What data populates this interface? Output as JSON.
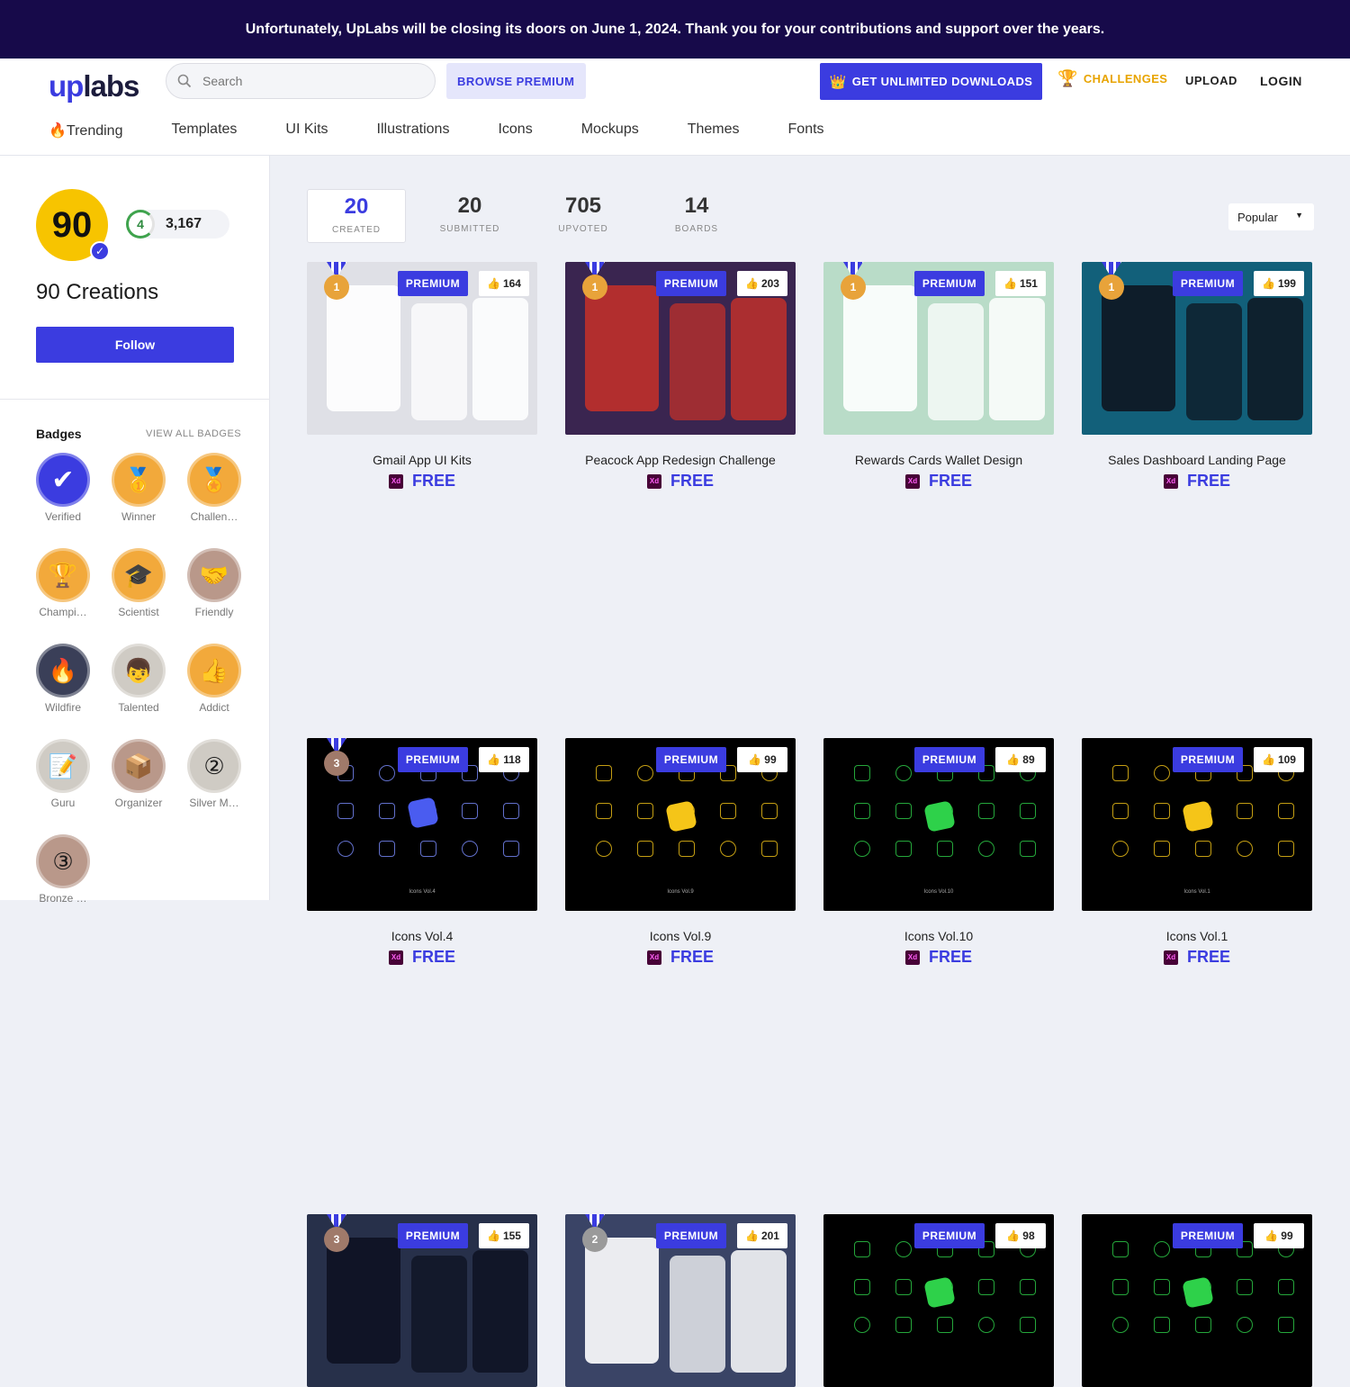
{
  "banner": {
    "text": "Unfortunately, UpLabs will be closing its doors on June 1, 2024. Thank you for your contributions and support over the years."
  },
  "header": {
    "logo_up": "up",
    "logo_labs": "labs",
    "search_placeholder": "Search",
    "browse_premium": "BROWSE PREMIUM",
    "unlimited": "GET UNLIMITED DOWNLOADS",
    "challenges": "CHALLENGES",
    "upload": "UPLOAD",
    "login": "LOGIN"
  },
  "nav": {
    "items": [
      "🔥Trending",
      "Templates",
      "UI Kits",
      "Illustrations",
      "Icons",
      "Mockups",
      "Themes",
      "Fonts"
    ]
  },
  "profile": {
    "level": "4",
    "points": "3,167",
    "creations": "90 Creations",
    "follow": "Follow",
    "avatar_glyph": "90"
  },
  "badges": {
    "title": "Badges",
    "view_all": "VIEW ALL BADGES",
    "items": [
      {
        "label": "Verified",
        "icon": "✔",
        "color": "#3b3ce0"
      },
      {
        "label": "Winner",
        "icon": "🥇",
        "color": "#f2a93b"
      },
      {
        "label": "Challen…",
        "icon": "🏅",
        "color": "#f2a93b"
      },
      {
        "label": "Champi…",
        "icon": "🏆",
        "color": "#f2a93b"
      },
      {
        "label": "Scientist",
        "icon": "🎓",
        "color": "#f2a93b"
      },
      {
        "label": "Friendly",
        "icon": "🤝",
        "color": "#b9988a"
      },
      {
        "label": "Wildfire",
        "icon": "🔥",
        "color": "#3a3f58"
      },
      {
        "label": "Talented",
        "icon": "👦",
        "color": "#cfcbc4"
      },
      {
        "label": "Addict",
        "icon": "👍",
        "color": "#f2a93b"
      },
      {
        "label": "Guru",
        "icon": "📝",
        "color": "#cfcbc4"
      },
      {
        "label": "Organizer",
        "icon": "📦",
        "color": "#b9988a"
      },
      {
        "label": "Silver M…",
        "icon": "②",
        "color": "#cfcbc4"
      },
      {
        "label": "Bronze …",
        "icon": "③",
        "color": "#b9988a"
      }
    ]
  },
  "stats": [
    {
      "num": "20",
      "label": "CREATED"
    },
    {
      "num": "20",
      "label": "SUBMITTED"
    },
    {
      "num": "705",
      "label": "UPVOTED"
    },
    {
      "num": "14",
      "label": "BOARDS"
    }
  ],
  "sort": {
    "value": "Popular"
  },
  "cards": [
    {
      "title": "Gmail App UI Kits",
      "likes": "164",
      "premium": "PREMIUM",
      "price": "FREE",
      "medal": "1",
      "bg": "#dfe0e6",
      "accent": "#ffffff"
    },
    {
      "title": "Peacock App Redesign Challenge",
      "likes": "203",
      "premium": "PREMIUM",
      "price": "FREE",
      "medal": "1",
      "bg": "#3a2550",
      "accent": "#c0302a"
    },
    {
      "title": "Rewards Cards Wallet Design",
      "likes": "151",
      "premium": "PREMIUM",
      "price": "FREE",
      "medal": "1",
      "bg": "#b9dcc8",
      "accent": "#ffffff"
    },
    {
      "title": "Sales Dashboard Landing Page",
      "likes": "199",
      "premium": "PREMIUM",
      "price": "FREE",
      "medal": "1",
      "bg": "#12607a",
      "accent": "#0e1621"
    },
    {
      "title": "Icons Vol.4",
      "likes": "118",
      "premium": "PREMIUM",
      "price": "FREE",
      "medal": "3",
      "bg": "#000000",
      "accent": "#4a5cf0",
      "icons_label": "Icons Vol.4"
    },
    {
      "title": "Icons Vol.9",
      "likes": "99",
      "premium": "PREMIUM",
      "price": "FREE",
      "medal": "",
      "bg": "#000000",
      "accent": "#f5c518",
      "icons_label": "Icons Vol.9"
    },
    {
      "title": "Icons Vol.10",
      "likes": "89",
      "premium": "PREMIUM",
      "price": "FREE",
      "medal": "",
      "bg": "#000000",
      "accent": "#2ed14a",
      "icons_label": "Icons Vol.10"
    },
    {
      "title": "Icons Vol.1",
      "likes": "109",
      "premium": "PREMIUM",
      "price": "FREE",
      "medal": "",
      "bg": "#000000",
      "accent": "#f5c518",
      "icons_label": "Icons Vol.1"
    },
    {
      "title": "",
      "likes": "155",
      "premium": "PREMIUM",
      "price": "",
      "medal": "3",
      "bg": "#27304a",
      "accent": "#0e1222"
    },
    {
      "title": "",
      "likes": "201",
      "premium": "PREMIUM",
      "price": "",
      "medal": "2",
      "bg": "#3a4466",
      "accent": "#ffffff"
    },
    {
      "title": "",
      "likes": "98",
      "premium": "PREMIUM",
      "price": "",
      "medal": "",
      "bg": "#000000",
      "accent": "#2ed14a"
    },
    {
      "title": "",
      "likes": "99",
      "premium": "PREMIUM",
      "price": "",
      "medal": "",
      "bg": "#000000",
      "accent": "#2ed14a"
    }
  ],
  "colors": {
    "brand": "#3b3ce0",
    "banner_bg": "#170a4a",
    "challenges": "#e8a400"
  }
}
